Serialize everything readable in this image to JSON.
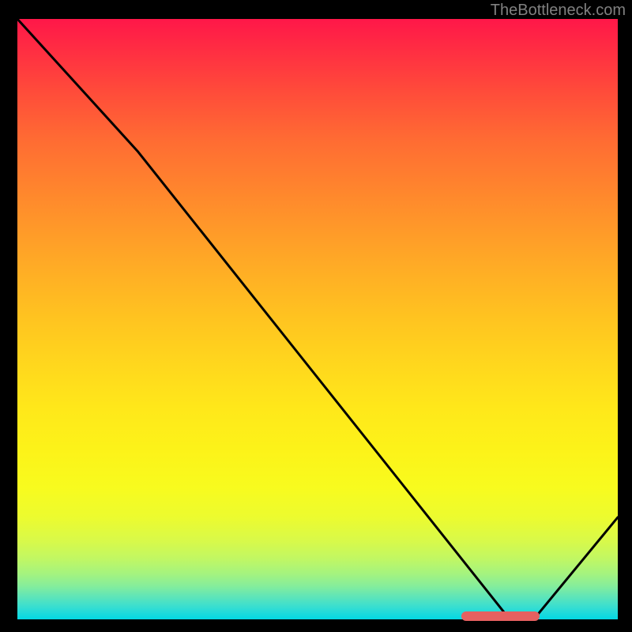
{
  "attribution": "TheBottleneck.com",
  "chart_data": {
    "type": "line",
    "title": "",
    "xlabel": "",
    "ylabel": "",
    "xlim": [
      0,
      1
    ],
    "ylim": [
      0,
      1
    ],
    "x": [
      0.0,
      0.2,
      0.82,
      0.86,
      1.0
    ],
    "y": [
      1.0,
      0.78,
      0.0,
      0.0,
      0.17
    ],
    "optimum_range": {
      "x_start": 0.74,
      "x_end": 0.87,
      "y": 0.005
    },
    "background_gradient": {
      "top": "#ff1749",
      "bottom": "#02d8e4",
      "description": "red-orange-yellow-green-cyan vertical gradient"
    }
  }
}
